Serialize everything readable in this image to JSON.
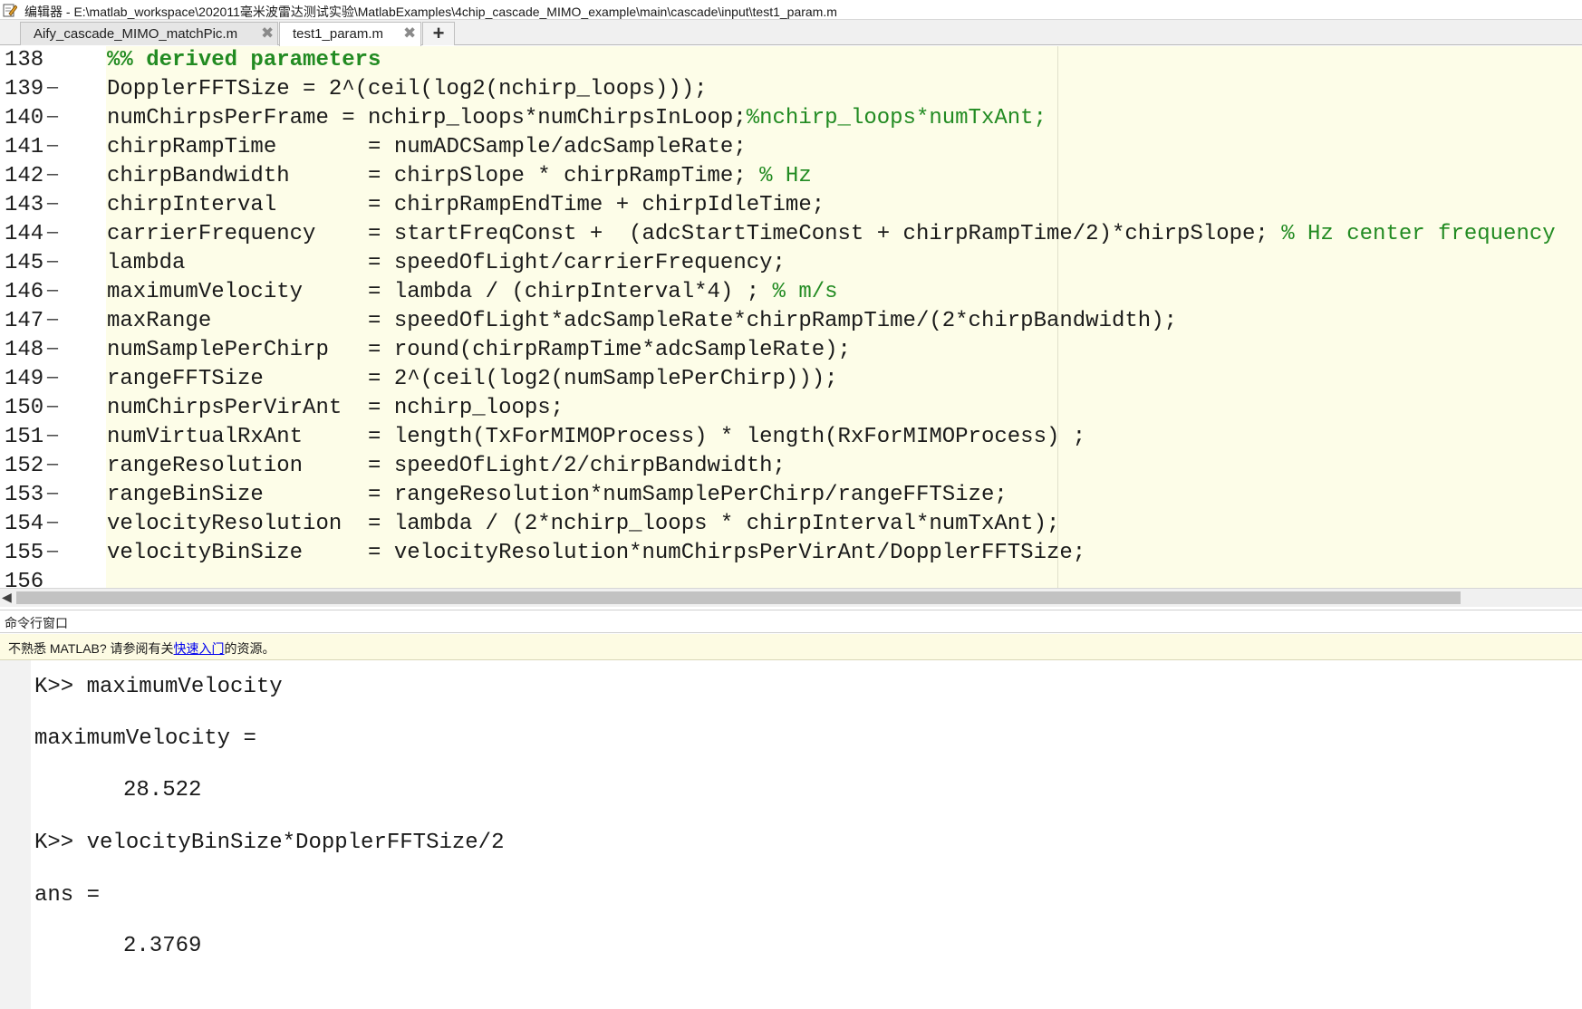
{
  "window": {
    "title": "编辑器 - E:\\matlab_workspace\\202011毫米波雷达测试实验\\MatlabExamples\\4chip_cascade_MIMO_example\\main\\cascade\\input\\test1_param.m"
  },
  "tabs": [
    {
      "label": "Aify_cascade_MIMO_matchPic.m",
      "close": "✖",
      "active": false
    },
    {
      "label": "test1_param.m",
      "close": "✖",
      "active": true
    }
  ],
  "add_tab_label": "+",
  "editor": {
    "lines": [
      {
        "num": "138",
        "marker": "",
        "text": "%% derived parameters",
        "comment": "",
        "section": true
      },
      {
        "num": "139",
        "marker": "—",
        "text": "DopplerFFTSize = 2^(ceil(log2(nchirp_loops)));",
        "comment": ""
      },
      {
        "num": "140",
        "marker": "—",
        "text": "numChirpsPerFrame = nchirp_loops*numChirpsInLoop;",
        "comment": "%nchirp_loops*numTxAnt;"
      },
      {
        "num": "141",
        "marker": "—",
        "text": "chirpRampTime       = numADCSample/adcSampleRate;",
        "comment": ""
      },
      {
        "num": "142",
        "marker": "—",
        "text": "chirpBandwidth      = chirpSlope * chirpRampTime; ",
        "comment": "% Hz"
      },
      {
        "num": "143",
        "marker": "—",
        "text": "chirpInterval       = chirpRampEndTime + chirpIdleTime;",
        "comment": ""
      },
      {
        "num": "144",
        "marker": "—",
        "text": "carrierFrequency    = startFreqConst +  (adcStartTimeConst + chirpRampTime/2)*chirpSlope; ",
        "comment": "% Hz center frequency"
      },
      {
        "num": "145",
        "marker": "—",
        "text": "lambda              = speedOfLight/carrierFrequency;",
        "comment": ""
      },
      {
        "num": "146",
        "marker": "—",
        "text": "maximumVelocity     = lambda / (chirpInterval*4) ; ",
        "comment": "% m/s"
      },
      {
        "num": "147",
        "marker": "—",
        "text": "maxRange            = speedOfLight*adcSampleRate*chirpRampTime/(2*chirpBandwidth);",
        "comment": ""
      },
      {
        "num": "148",
        "marker": "—",
        "text": "numSamplePerChirp   = round(chirpRampTime*adcSampleRate);",
        "comment": ""
      },
      {
        "num": "149",
        "marker": "—",
        "text": "rangeFFTSize        = 2^(ceil(log2(numSamplePerChirp)));",
        "comment": ""
      },
      {
        "num": "150",
        "marker": "—",
        "text": "numChirpsPerVirAnt  = nchirp_loops;",
        "comment": ""
      },
      {
        "num": "151",
        "marker": "—",
        "text": "numVirtualRxAnt     = length(TxForMIMOProcess) * length(RxForMIMOProcess) ;",
        "comment": ""
      },
      {
        "num": "152",
        "marker": "—",
        "text": "rangeResolution     = speedOfLight/2/chirpBandwidth;",
        "comment": ""
      },
      {
        "num": "153",
        "marker": "—",
        "text": "rangeBinSize        = rangeResolution*numSamplePerChirp/rangeFFTSize;",
        "comment": ""
      },
      {
        "num": "154",
        "marker": "—",
        "text": "velocityResolution  = lambda / (2*nchirp_loops * chirpInterval*numTxAnt);",
        "comment": ""
      },
      {
        "num": "155",
        "marker": "—",
        "text": "velocityBinSize     = velocityResolution*numChirpsPerVirAnt/DopplerFFTSize;",
        "comment": ""
      },
      {
        "num": "156",
        "marker": "",
        "text": "",
        "comment": ""
      }
    ]
  },
  "scrollbar": {
    "left_arrow": "◀"
  },
  "command_window": {
    "title": "命令行窗口",
    "notice_before": "不熟悉 MATLAB? 请参阅有关",
    "notice_link": "快速入门",
    "notice_after": "的资源。",
    "lines": [
      "K>> maximumVelocity",
      "maximumVelocity =",
      "28.522",
      "K>> velocityBinSize*DopplerFFTSize/2",
      "ans =",
      "2.3769"
    ]
  }
}
